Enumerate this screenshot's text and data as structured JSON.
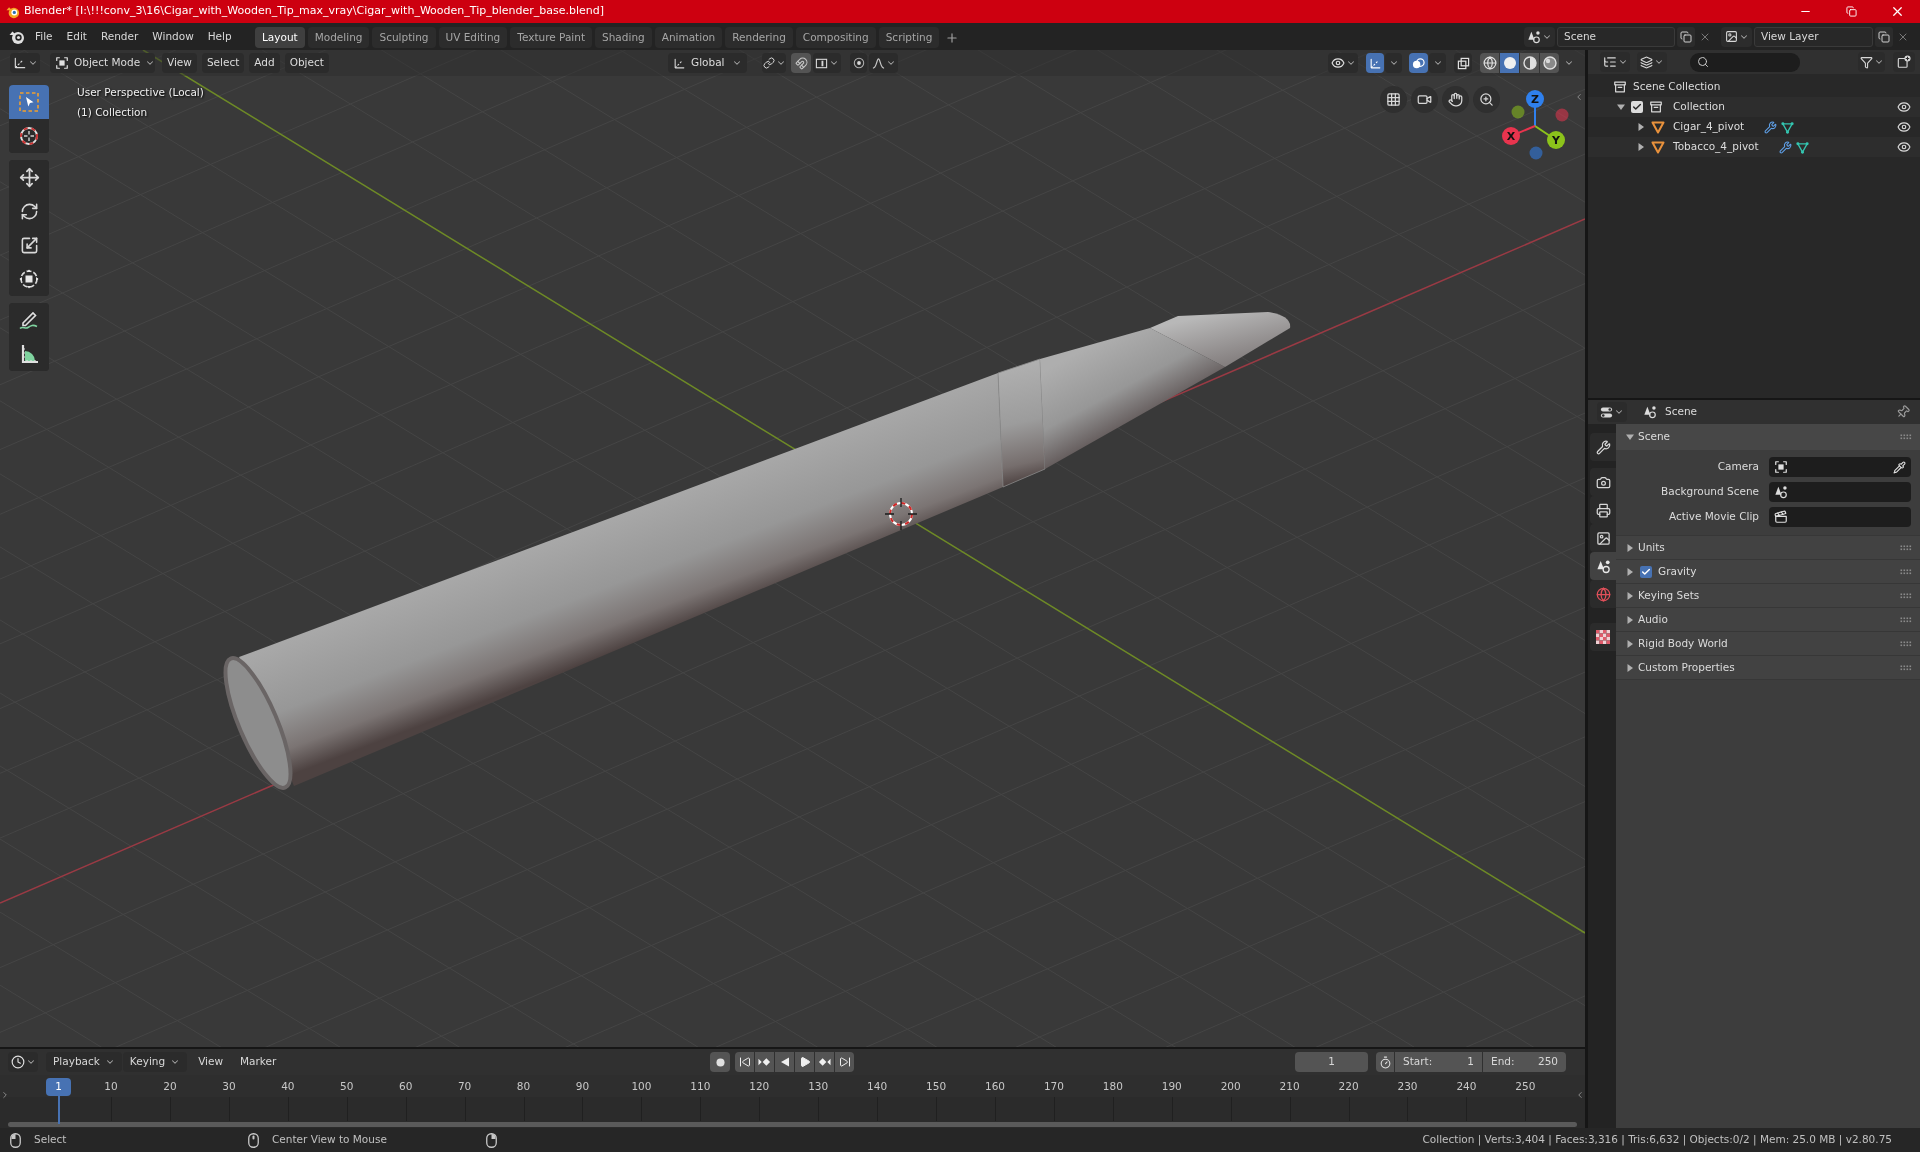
{
  "title_bar": {
    "title": "Blender* [I:\\!!!conv_3\\16\\Cigar_with_Wooden_Tip_max_vray\\Cigar_with_Wooden_Tip_blender_base.blend]"
  },
  "top_bar": {
    "menus": [
      "File",
      "Edit",
      "Render",
      "Window",
      "Help"
    ],
    "workspace_tabs": [
      {
        "label": "Layout",
        "selected": true
      },
      {
        "label": "Modeling",
        "selected": false
      },
      {
        "label": "Sculpting",
        "selected": false
      },
      {
        "label": "UV Editing",
        "selected": false
      },
      {
        "label": "Texture Paint",
        "selected": false
      },
      {
        "label": "Shading",
        "selected": false
      },
      {
        "label": "Animation",
        "selected": false
      },
      {
        "label": "Rendering",
        "selected": false
      },
      {
        "label": "Compositing",
        "selected": false
      },
      {
        "label": "Scripting",
        "selected": false
      }
    ],
    "scene": "Scene",
    "view_layer": "View Layer"
  },
  "viewport": {
    "mode": "Object Mode",
    "menus": [
      "View",
      "Select",
      "Add",
      "Object"
    ],
    "orientation": "Global",
    "toggles": [
      {
        "kind": "selectability",
        "on": false
      },
      {
        "kind": "gizmos",
        "on": true
      },
      {
        "kind": "overlays",
        "on": true
      },
      {
        "kind": "xray",
        "on": false
      }
    ],
    "shading": [
      {
        "kind": "wireframe",
        "selected": false
      },
      {
        "kind": "solid",
        "selected": true
      },
      {
        "kind": "material",
        "selected": false
      },
      {
        "kind": "rendered",
        "selected": false
      }
    ],
    "tool_groups": [
      {
        "tools": [
          {
            "kind": "select_box",
            "selected": true
          },
          {
            "kind": "cursor",
            "selected": false
          }
        ]
      },
      {
        "tools": [
          {
            "kind": "move",
            "selected": false
          },
          {
            "kind": "rotate",
            "selected": false
          },
          {
            "kind": "scale",
            "selected": false
          },
          {
            "kind": "transform",
            "selected": false
          }
        ]
      },
      {
        "tools": [
          {
            "kind": "annotate",
            "selected": false
          },
          {
            "kind": "measure",
            "selected": false
          }
        ]
      }
    ],
    "view_name": "User Perspective (Local)",
    "collection_label": "(1) Collection",
    "gizmo_axes": [
      {
        "label": "Z",
        "color": "#2f80ed"
      },
      {
        "label": "Y",
        "color": "#8cc31b"
      },
      {
        "label": "X",
        "color": "#e8344e"
      }
    ]
  },
  "outliner": {
    "root": "Scene Collection",
    "items": [
      {
        "kind": "collection",
        "name": "Collection",
        "checked": true,
        "expanded": true,
        "visible": true,
        "children": [
          {
            "kind": "object",
            "name": "Cigar_4_pivot",
            "expanded": false,
            "visible": true
          },
          {
            "kind": "object",
            "name": "Tobacco_4_pivot",
            "expanded": false,
            "visible": true
          }
        ]
      }
    ]
  },
  "properties": {
    "context": "Scene",
    "tab_groups": [
      {
        "tabs": [
          {
            "kind": "tool",
            "selected": false
          }
        ]
      },
      {
        "tabs": [
          {
            "kind": "render",
            "selected": false
          },
          {
            "kind": "output",
            "selected": false
          },
          {
            "kind": "view_layer",
            "selected": false
          },
          {
            "kind": "scene",
            "selected": true
          },
          {
            "kind": "world",
            "selected": false
          }
        ]
      },
      {
        "tabs": [
          {
            "kind": "texture",
            "selected": false
          }
        ]
      }
    ],
    "panels": [
      {
        "kind": "plain",
        "title": "Scene",
        "expanded": true,
        "fields": [
          {
            "kind": "camera",
            "label": "Camera"
          },
          {
            "kind": "scene",
            "label": "Background Scene"
          },
          {
            "kind": "clip",
            "label": "Active Movie Clip"
          }
        ]
      },
      {
        "kind": "plain",
        "title": "Units",
        "expanded": false
      },
      {
        "kind": "toggle",
        "title": "Gravity",
        "expanded": false,
        "checked": true
      },
      {
        "kind": "plain",
        "title": "Keying Sets",
        "expanded": false
      },
      {
        "kind": "plain",
        "title": "Audio",
        "expanded": false
      },
      {
        "kind": "plain",
        "title": "Rigid Body World",
        "expanded": false
      },
      {
        "kind": "plain",
        "title": "Custom Properties",
        "expanded": false
      }
    ]
  },
  "timeline": {
    "menus": [
      {
        "kind": "dropdown",
        "label": "Playback"
      },
      {
        "kind": "dropdown",
        "label": "Keying"
      },
      {
        "kind": "menu",
        "label": "View"
      },
      {
        "kind": "menu",
        "label": "Marker"
      }
    ],
    "current_frame": "1",
    "start_label": "Start:",
    "start": "1",
    "end_label": "End:",
    "end": "250",
    "playhead": "1",
    "ruler": [
      "10",
      "20",
      "30",
      "40",
      "50",
      "60",
      "70",
      "80",
      "90",
      "100",
      "110",
      "120",
      "130",
      "140",
      "150",
      "160",
      "170",
      "180",
      "190",
      "200",
      "210",
      "220",
      "230",
      "240",
      "250"
    ]
  },
  "status_bar": {
    "hints": [
      {
        "kind": "left",
        "label": "Select"
      },
      {
        "kind": "middle",
        "label": "Center View to Mouse"
      },
      {
        "kind": "right"
      }
    ],
    "stats": "Collection | Verts:3,404 | Faces:3,316 | Tris:6,632 | Objects:0/2 | Mem: 25.0 MB | v2.80.75"
  }
}
